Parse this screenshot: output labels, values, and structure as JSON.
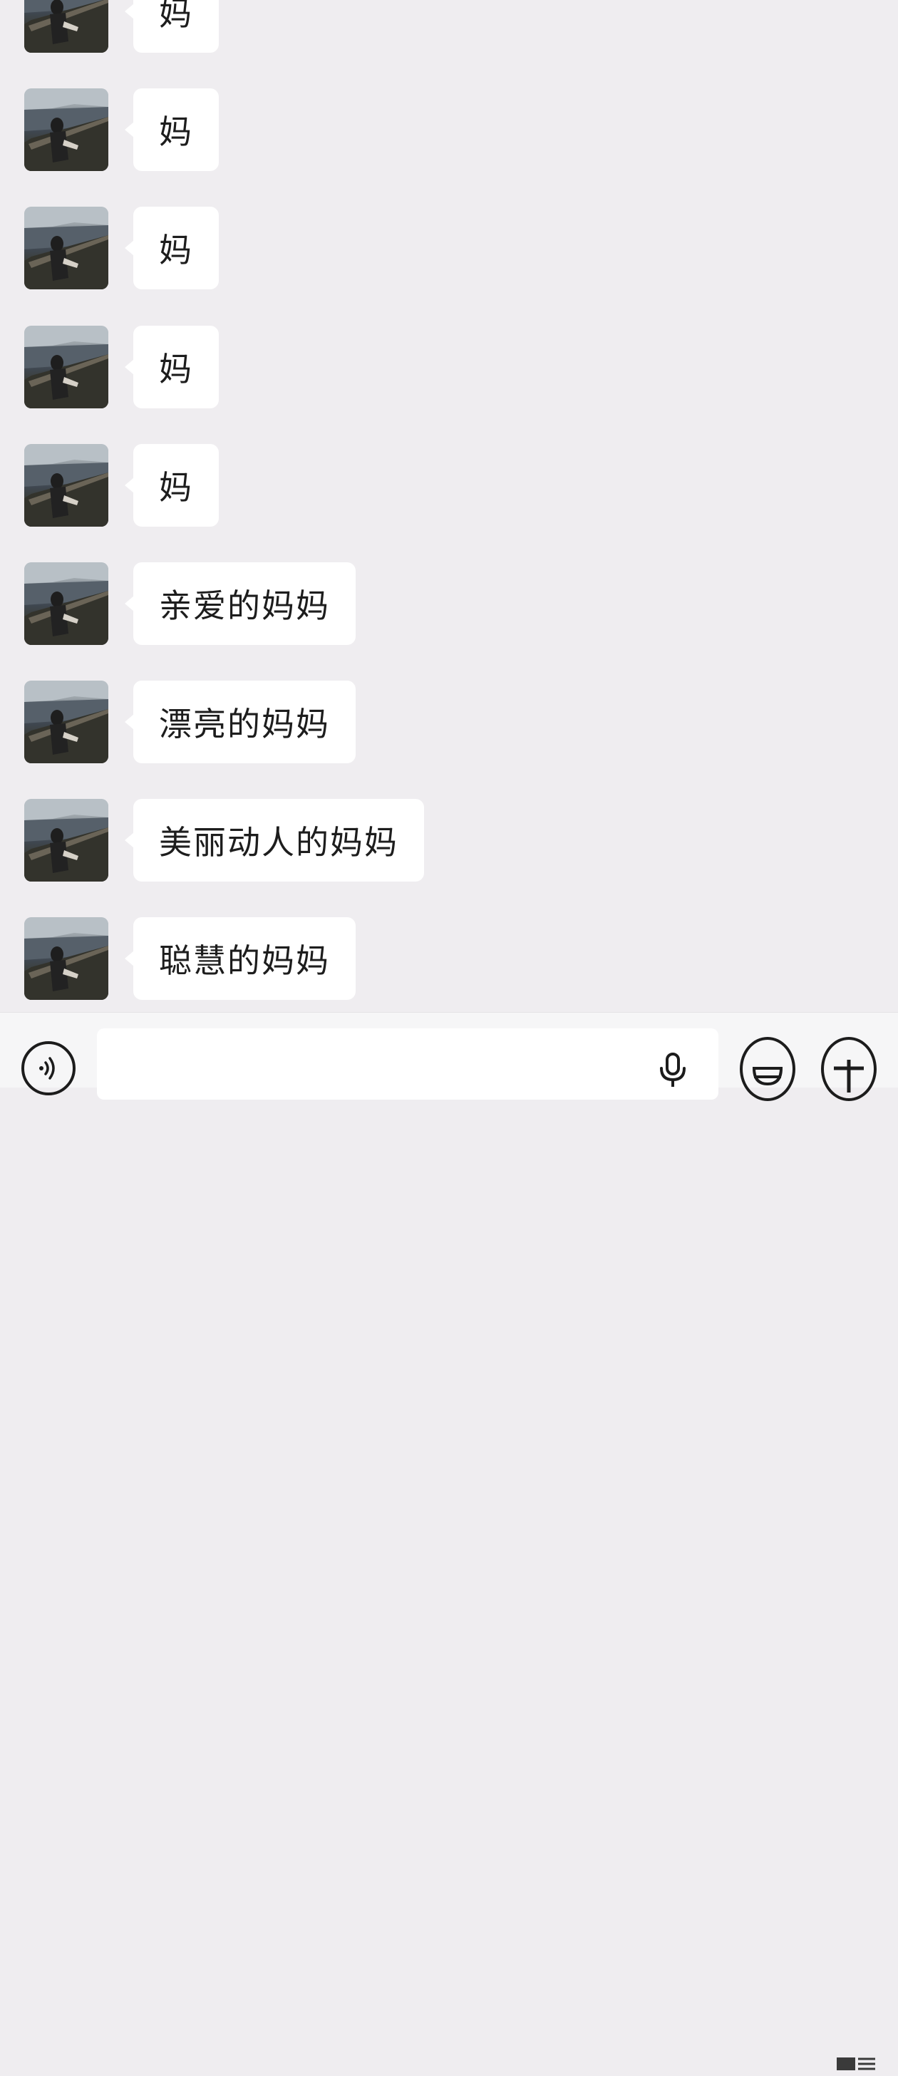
{
  "messages": [
    {
      "text": "妈",
      "avatar_icon": "seaside-person-avatar"
    },
    {
      "text": "妈",
      "avatar_icon": "seaside-person-avatar"
    },
    {
      "text": "妈",
      "avatar_icon": "seaside-person-avatar"
    },
    {
      "text": "妈",
      "avatar_icon": "seaside-person-avatar"
    },
    {
      "text": "妈",
      "avatar_icon": "seaside-person-avatar"
    },
    {
      "text": "亲爱的妈妈",
      "avatar_icon": "seaside-person-avatar"
    },
    {
      "text": "漂亮的妈妈",
      "avatar_icon": "seaside-person-avatar"
    },
    {
      "text": "美丽动人的妈妈",
      "avatar_icon": "seaside-person-avatar"
    },
    {
      "text": "聪慧的妈妈",
      "avatar_icon": "seaside-person-avatar"
    }
  ],
  "input_bar": {
    "value": "",
    "voice_icon": "voice-mode-icon",
    "mic_icon": "microphone-icon",
    "emoji_icon": "emoji-icon",
    "plus_icon": "plus-icon"
  },
  "colors": {
    "background": "#efedf0",
    "bubble": "#ffffff",
    "text": "#1d1d1d",
    "input_bar": "#f6f6f7"
  }
}
